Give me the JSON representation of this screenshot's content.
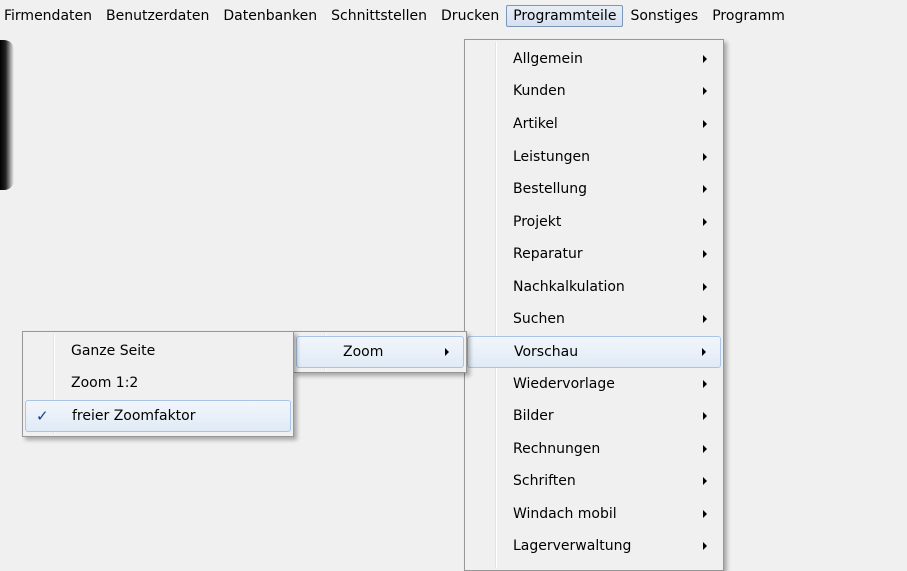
{
  "menubar": {
    "items": [
      "Firmendaten",
      "Benutzerdaten",
      "Datenbanken",
      "Schnittstellen",
      "Drucken",
      "Programmteile",
      "Sonstiges",
      "Programm"
    ],
    "active": "Programmteile"
  },
  "programmteile_menu": {
    "items": [
      "Allgemein",
      "Kunden",
      "Artikel",
      "Leistungen",
      "Bestellung",
      "Projekt",
      "Reparatur",
      "Nachkalkulation",
      "Suchen",
      "Vorschau",
      "Wiedervorlage",
      "Bilder",
      "Rechnungen",
      "Schriften",
      "Windach mobil",
      "Lagerverwaltung"
    ],
    "highlighted": "Vorschau"
  },
  "vorschau_menu": {
    "items": [
      "Zoom"
    ]
  },
  "zoom_menu": {
    "items": [
      "Ganze Seite",
      "Zoom 1:2",
      "freier Zoomfaktor"
    ],
    "checked": "freier Zoomfaktor",
    "check_glyph": "✓"
  },
  "icons": {
    "submenu_arrow": "submenu-arrow-icon",
    "check": "check-icon"
  }
}
